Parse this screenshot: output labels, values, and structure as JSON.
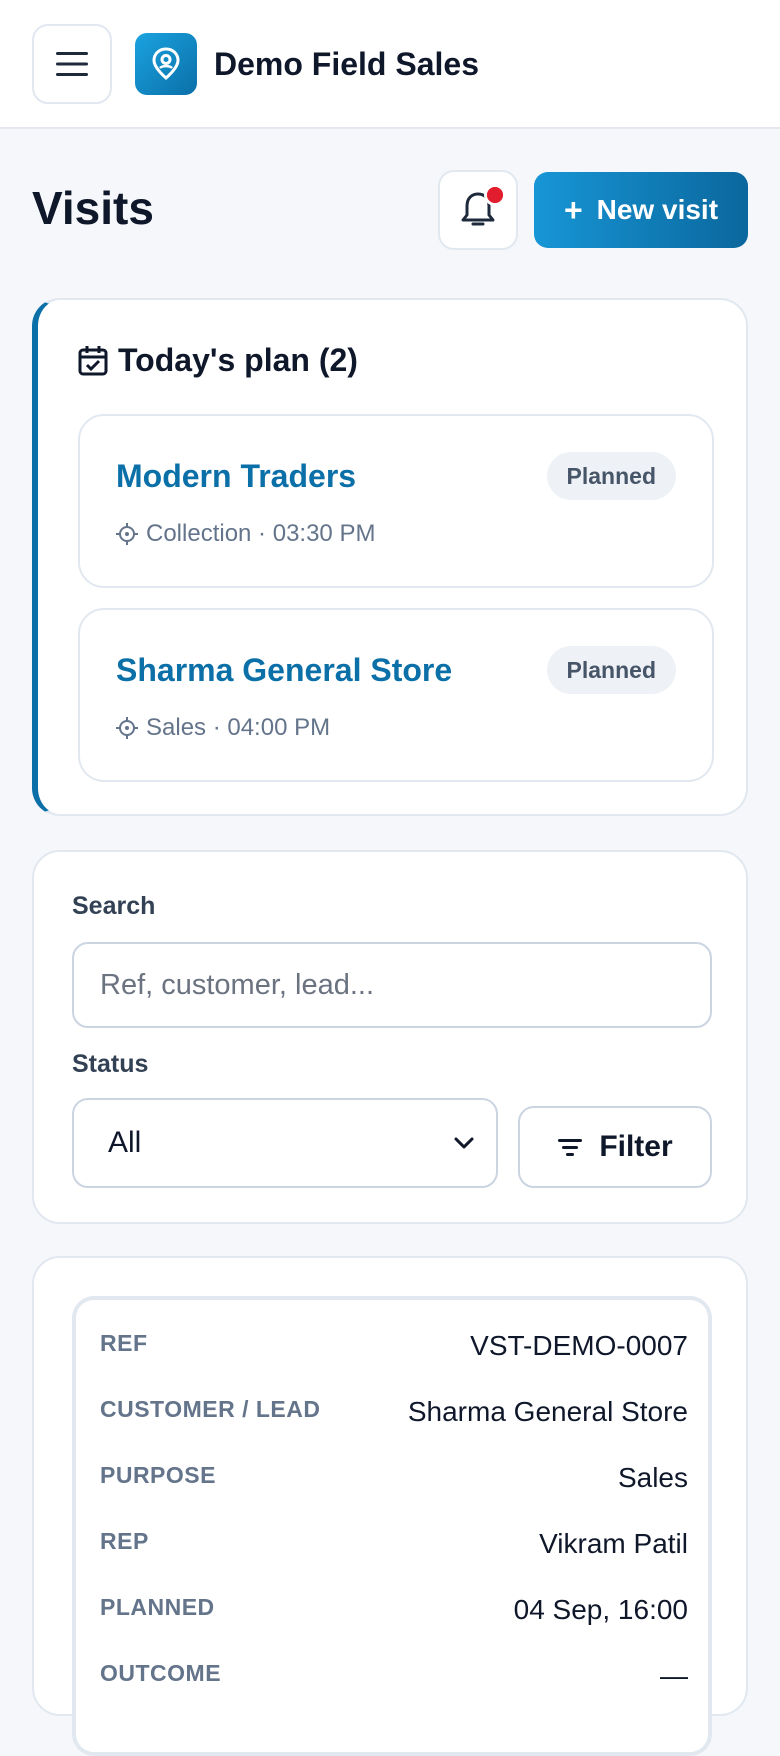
{
  "header": {
    "app_title": "Demo Field Sales",
    "menu_icon": "hamburger-icon",
    "logo_icon": "map-pin-icon"
  },
  "page": {
    "title": "Visits",
    "new_visit_label": "New visit",
    "new_visit_plus": "+",
    "bell_icon": "bell-icon"
  },
  "today_plan": {
    "title": "Today's plan (2)",
    "items": [
      {
        "name": "Modern Traders",
        "meta": "Collection · 03:30 PM",
        "status": "Planned"
      },
      {
        "name": "Sharma General Store",
        "meta": "Sales · 04:00 PM",
        "status": "Planned"
      }
    ]
  },
  "filters": {
    "search_label": "Search",
    "search_placeholder": "Ref, customer, lead...",
    "search_value": "",
    "status_label": "Status",
    "status_value": "All",
    "filter_button": "Filter"
  },
  "visits": [
    {
      "fields": [
        {
          "label": "REF",
          "value": "VST-DEMO-0007"
        },
        {
          "label": "CUSTOMER / LEAD",
          "value": "Sharma General Store"
        },
        {
          "label": "PURPOSE",
          "value": "Sales"
        },
        {
          "label": "REP",
          "value": "Vikram Patil"
        },
        {
          "label": "PLANNED",
          "value": "04 Sep, 16:00"
        },
        {
          "label": "OUTCOME",
          "value": "—"
        }
      ]
    }
  ],
  "colors": {
    "brand": "#0b6fa8",
    "brand_light": "#1aa3e0",
    "badge_bg": "#eef2f6",
    "notification_dot": "#e11d2e"
  }
}
